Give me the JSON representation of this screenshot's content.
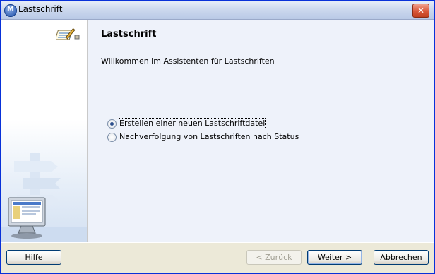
{
  "window": {
    "title": "Lastschrift"
  },
  "icons": {
    "app": "app-logo-icon",
    "close": "close-icon",
    "wizard": "notepad-pencil-icon",
    "monitor": "computer-monitor-icon"
  },
  "main": {
    "title": "Lastschrift",
    "welcome": "Willkommen im Assistenten für Lastschriften",
    "options": [
      {
        "label": "Erstellen einer neuen Lastschriftdatei",
        "checked": true
      },
      {
        "label": "Nachverfolgung von Lastschriften nach Status",
        "checked": false
      }
    ]
  },
  "buttons": {
    "help": "Hilfe",
    "back": "< Zurück",
    "next": "Weiter >",
    "cancel": "Abbrechen"
  },
  "colors": {
    "accent": "#0831d9",
    "panel": "#eef2fa",
    "face": "#ece9d8"
  }
}
